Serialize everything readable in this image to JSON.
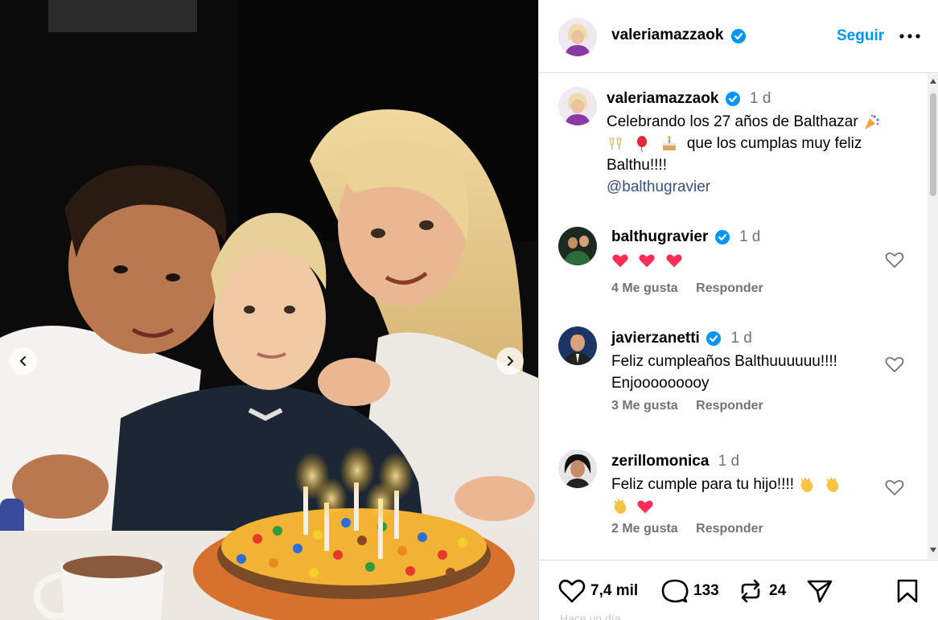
{
  "post": {
    "author": "valeriamazzaok",
    "follow_label": "Seguir",
    "caption": {
      "time": "1 d",
      "text_line1": "Celebrando los 27 años de Balthazar",
      "text_line2": "que los cumplas muy feliz",
      "text_line3": "Balthu!!!!",
      "mention": "@balthugravier"
    }
  },
  "comments": [
    {
      "user": "balthugravier",
      "verified": true,
      "time": "1 d",
      "text": "",
      "likes": "4 Me gusta",
      "reply": "Responder"
    },
    {
      "user": "javierzanetti",
      "verified": true,
      "time": "1 d",
      "text_line1": "Feliz cumpleaños Balthuuuuuu!!!!",
      "text_line2": "Enjooooooooy",
      "likes": "3 Me gusta",
      "reply": "Responder"
    },
    {
      "user": "zerillomonica",
      "verified": false,
      "time": "1 d",
      "text": "Feliz cumple para tu hijo!!!!",
      "likes": "2 Me gusta",
      "reply": "Responder"
    }
  ],
  "actions": {
    "likes": "7,4 mil",
    "comments": "133",
    "reposts": "24"
  },
  "footer_partial": "Hace un día",
  "colors": {
    "link": "#0095f6",
    "verified": "#0095f6",
    "heart": "#ff3040",
    "muted": "#737373"
  },
  "icons": [
    "chevron-left-icon",
    "chevron-right-icon",
    "verified-icon",
    "more-icon",
    "heart-icon",
    "comment-icon",
    "repost-icon",
    "share-icon",
    "save-icon"
  ]
}
